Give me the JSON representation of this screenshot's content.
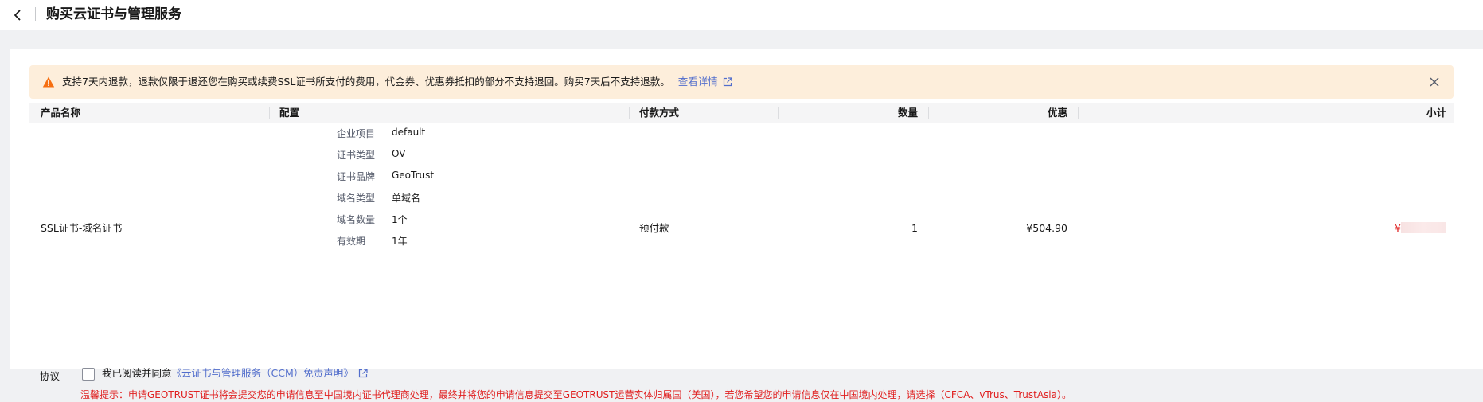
{
  "header": {
    "title": "购买云证书与管理服务"
  },
  "notice": {
    "text": "支持7天内退款，退款仅限于退还您在购买或续费SSL证书所支付的费用，代金券、优惠券抵扣的部分不支持退回。购买7天后不支持退款。",
    "link_label": "查看详情"
  },
  "table": {
    "columns": [
      "产品名称",
      "配置",
      "付款方式",
      "数量",
      "优惠",
      "小计"
    ],
    "row": {
      "product": "SSL证书-域名证书",
      "config": [
        {
          "label": "企业项目",
          "value": "default"
        },
        {
          "label": "证书类型",
          "value": "OV"
        },
        {
          "label": "证书品牌",
          "value": "GeoTrust"
        },
        {
          "label": "域名类型",
          "value": "单域名"
        },
        {
          "label": "域名数量",
          "value": "1个"
        },
        {
          "label": "有效期",
          "value": "1年"
        }
      ],
      "payment": "预付款",
      "quantity": "1",
      "discount": "¥504.90",
      "subtotal_prefix": "¥"
    }
  },
  "agreement": {
    "label": "协议",
    "text_prefix": "我已阅读并同意",
    "link_label": "《云证书与管理服务（CCM）免责声明》",
    "warning": "温馨提示：申请GEOTRUST证书将会提交您的申请信息至中国境内证书代理商处理，最终并将您的申请信息提交至GEOTRUST运营实体归属国（美国），若您希望您的申请信息仅在中国境内处理，请选择（CFCA、vTrus、TrustAsia）。"
  }
}
